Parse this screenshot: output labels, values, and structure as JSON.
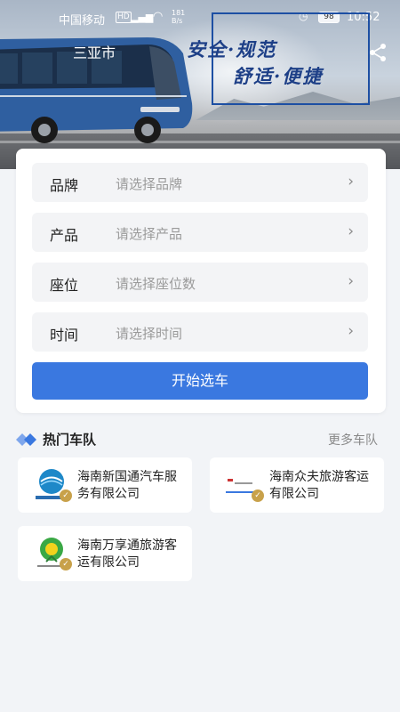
{
  "status_bar": {
    "carrier": "中国移动",
    "network": "HD",
    "signal": "4G",
    "speed": "181 B/s",
    "battery": "98",
    "time": "10:52"
  },
  "header": {
    "city": "三亚市",
    "slogan_line1": "安全·规范",
    "slogan_line2": "舒适·便捷"
  },
  "form": {
    "rows": [
      {
        "label": "品牌",
        "placeholder": "请选择品牌"
      },
      {
        "label": "产品",
        "placeholder": "请选择产品"
      },
      {
        "label": "座位",
        "placeholder": "请选择座位数"
      },
      {
        "label": "时间",
        "placeholder": "请选择时间"
      }
    ],
    "chevron": "›",
    "submit_label": "开始选车"
  },
  "fleet_section": {
    "title": "热门车队",
    "more_label": "更多车队",
    "items": [
      {
        "name": "海南新国通汽车服务有限公司"
      },
      {
        "name": "海南众夫旅游客运有限公司"
      },
      {
        "name": "海南万享通旅游客运有限公司"
      }
    ]
  },
  "colors": {
    "accent": "#3a78e0",
    "slogan": "#1d3f87",
    "verified_badge": "#c8a14a",
    "page_bg": "#f2f4f7"
  }
}
